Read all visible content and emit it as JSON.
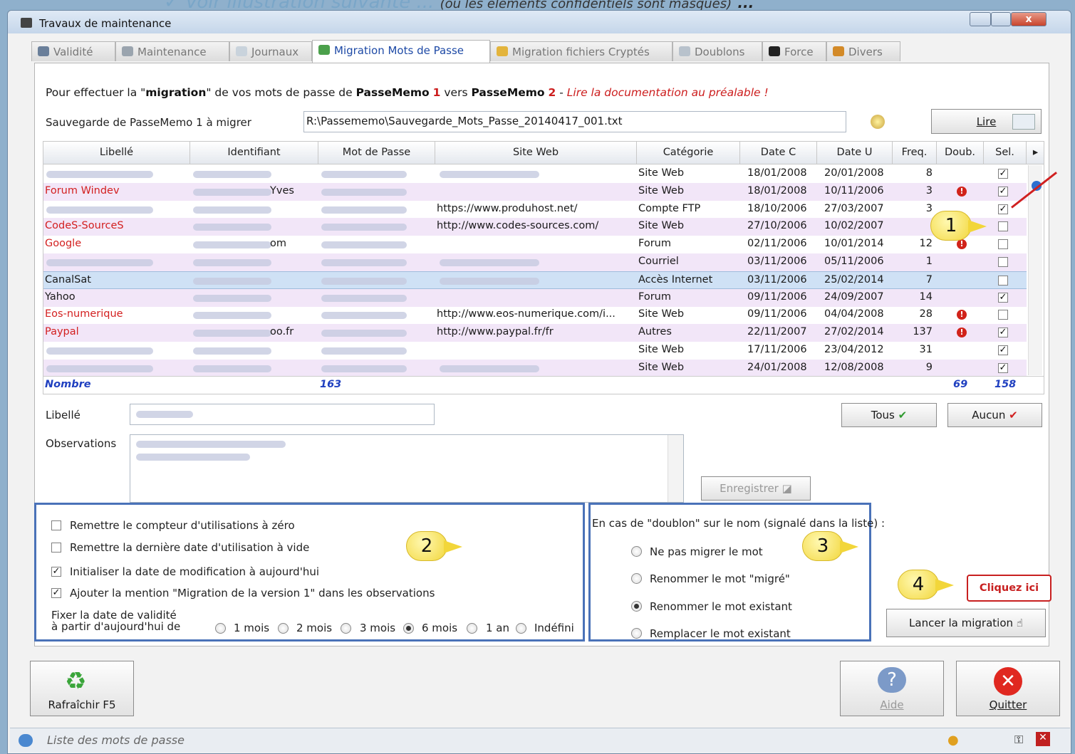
{
  "caption": {
    "line": "Voir illustration suivante ...",
    "note": "(où les éléments confidentiels sont masqués)",
    "dots": "..."
  },
  "window": {
    "title": "Travaux de maintenance",
    "close": "x"
  },
  "tabs": [
    {
      "label": "Validité"
    },
    {
      "label": "Maintenance"
    },
    {
      "label": "Journaux"
    },
    {
      "label": "Migration Mots de Passe"
    },
    {
      "label": "Migration fichiers Cryptés"
    },
    {
      "label": "Doublons"
    },
    {
      "label": "Force"
    },
    {
      "label": "Divers"
    }
  ],
  "intro": {
    "p1": "Pour effectuer la \"",
    "b1": "migration",
    "p2": "\" de vos mots de passe de ",
    "b2": "PasseMemo",
    "n1": "1",
    "p3": " vers ",
    "b3": "PasseMemo",
    "n2": "2",
    "p4": " - ",
    "doc": "Lire la documentation au préalable !"
  },
  "backup": {
    "label": "Sauvegarde de PasseMemo 1 à migrer",
    "path": "R:\\Passememo\\Sauvegarde_Mots_Passe_20140417_001.txt",
    "read_button": "Lire"
  },
  "grid": {
    "headers": [
      "Libellé",
      "Identifiant",
      "Mot de Passe",
      "Site Web",
      "Catégorie",
      "Date C",
      "Date U",
      "Freq.",
      "Doub.",
      "Sel."
    ],
    "rows": [
      {
        "libelle": "",
        "ident": "",
        "site": "",
        "cat": "Site Web",
        "dc": "18/01/2008",
        "du": "20/01/2008",
        "freq": "8",
        "doub": false,
        "sel": true,
        "red": false
      },
      {
        "libelle": "Forum Windev",
        "ident": "Yves",
        "site": "",
        "cat": "Site Web",
        "dc": "18/01/2008",
        "du": "10/11/2006",
        "freq": "3",
        "doub": true,
        "sel": true,
        "red": true
      },
      {
        "libelle": "",
        "ident": "",
        "site": "https://www.produhost.net/",
        "cat": "Compte FTP",
        "dc": "18/10/2006",
        "du": "27/03/2007",
        "freq": "3",
        "doub": false,
        "sel": true,
        "red": false
      },
      {
        "libelle": "CodeS-SourceS",
        "ident": "",
        "site": "http://www.codes-sources.com/",
        "cat": "Site Web",
        "dc": "27/10/2006",
        "du": "10/02/2007",
        "freq": "",
        "doub": false,
        "sel": false,
        "red": true
      },
      {
        "libelle": "Google",
        "ident": "om",
        "site": "",
        "cat": "Forum",
        "dc": "02/11/2006",
        "du": "10/01/2014",
        "freq": "12",
        "doub": true,
        "sel": false,
        "red": true
      },
      {
        "libelle": "",
        "ident": "",
        "site": "",
        "cat": "Courriel",
        "dc": "03/11/2006",
        "du": "05/11/2006",
        "freq": "1",
        "doub": false,
        "sel": false,
        "red": false
      },
      {
        "libelle": "CanalSat",
        "ident": "",
        "site": "",
        "cat": "Accès Internet",
        "dc": "03/11/2006",
        "du": "25/02/2014",
        "freq": "7",
        "doub": false,
        "sel": false,
        "red": false
      },
      {
        "libelle": "Yahoo",
        "ident": "",
        "site": "",
        "cat": "Forum",
        "dc": "09/11/2006",
        "du": "24/09/2007",
        "freq": "14",
        "doub": false,
        "sel": true,
        "red": false
      },
      {
        "libelle": "Eos-numerique",
        "ident": "",
        "site": "http://www.eos-numerique.com/i...",
        "cat": "Site Web",
        "dc": "09/11/2006",
        "du": "04/04/2008",
        "freq": "28",
        "doub": true,
        "sel": false,
        "red": true
      },
      {
        "libelle": "Paypal",
        "ident": "oo.fr",
        "site": "http://www.paypal.fr/fr",
        "cat": "Autres",
        "dc": "22/11/2007",
        "du": "27/02/2014",
        "freq": "137",
        "doub": true,
        "sel": true,
        "red": true
      },
      {
        "libelle": "",
        "ident": "",
        "site": "",
        "cat": "Site Web",
        "dc": "17/11/2006",
        "du": "23/04/2012",
        "freq": "31",
        "doub": false,
        "sel": true,
        "red": false
      },
      {
        "libelle": "",
        "ident": "",
        "site": "",
        "cat": "Site Web",
        "dc": "24/01/2008",
        "du": "12/08/2008",
        "freq": "9",
        "doub": false,
        "sel": true,
        "red": false
      }
    ],
    "footer": {
      "label": "Nombre",
      "count": "163",
      "doub": "69",
      "sel": "158"
    }
  },
  "libelle": {
    "label": "Libellé"
  },
  "observations": {
    "label": "Observations"
  },
  "buttons": {
    "tous": "Tous",
    "aucun": "Aucun",
    "enregistrer": "Enregistrer",
    "lancer": "Lancer la migration",
    "refresh": "Rafraîchir F5",
    "aide": "Aide",
    "quitter": "Quitter"
  },
  "options": {
    "c1": "Remettre le compteur d'utilisations à zéro",
    "c2": "Remettre la dernière date d'utilisation à vide",
    "c3": "Initialiser la date de modification à aujourd'hui",
    "c4": "Ajouter la mention \"Migration de la version 1\" dans les observations",
    "validity1": "Fixer la date de validité",
    "validity2": "à partir d'aujourd'hui de",
    "r1": "1 mois",
    "r2": "2 mois",
    "r3": "3 mois",
    "r4": "6 mois",
    "r5": "1 an",
    "r6": "Indéfini"
  },
  "doublon": {
    "title": "En cas de \"doublon\" sur le nom (signalé dans la liste) :",
    "o1": "Ne pas migrer le mot",
    "o2": "Renommer le mot \"migré\"",
    "o3": "Renommer le mot existant",
    "o4": "Remplacer le mot existant"
  },
  "callouts": {
    "b1": "1",
    "b2": "2",
    "b3": "3",
    "b4": "4",
    "cliquez": "Cliquez ici"
  },
  "status": {
    "text": "Liste des mots de passe"
  }
}
